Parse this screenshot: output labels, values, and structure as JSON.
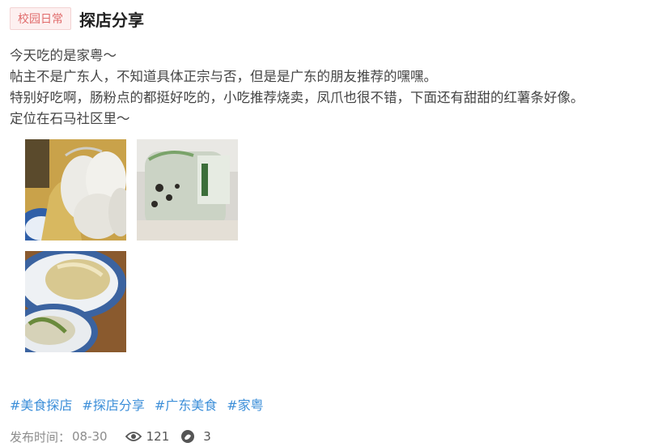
{
  "post": {
    "category": "校园日常",
    "title": "探店分享",
    "content": [
      "今天吃的是家粤～",
      "帖主不是广东人，不知道具体正宗与否，但是是广东的朋友推荐的嘿嘿。",
      "特别好吃啊，肠粉点的都挺好吃的，小吃推荐烧卖，凤爪也很不错，下面还有甜甜的红薯条好像。",
      "定位在石马社区里～"
    ],
    "images": [
      {
        "icon": "photo-rice-rolls"
      },
      {
        "icon": "photo-drink-bottle"
      },
      {
        "icon": "photo-dish-plate"
      }
    ],
    "hashtags": [
      "#美食探店",
      "#探店分享",
      "#广东美食",
      "#家粤"
    ],
    "meta": {
      "date_label": "发布时间：",
      "date": "08-30",
      "views": "121",
      "comments": "3"
    }
  },
  "colors": {
    "tag_text": "#e06b6b",
    "tag_bg": "#fdf0f0",
    "hashtag": "#3d8fd9",
    "meta": "#8c8c8c"
  }
}
